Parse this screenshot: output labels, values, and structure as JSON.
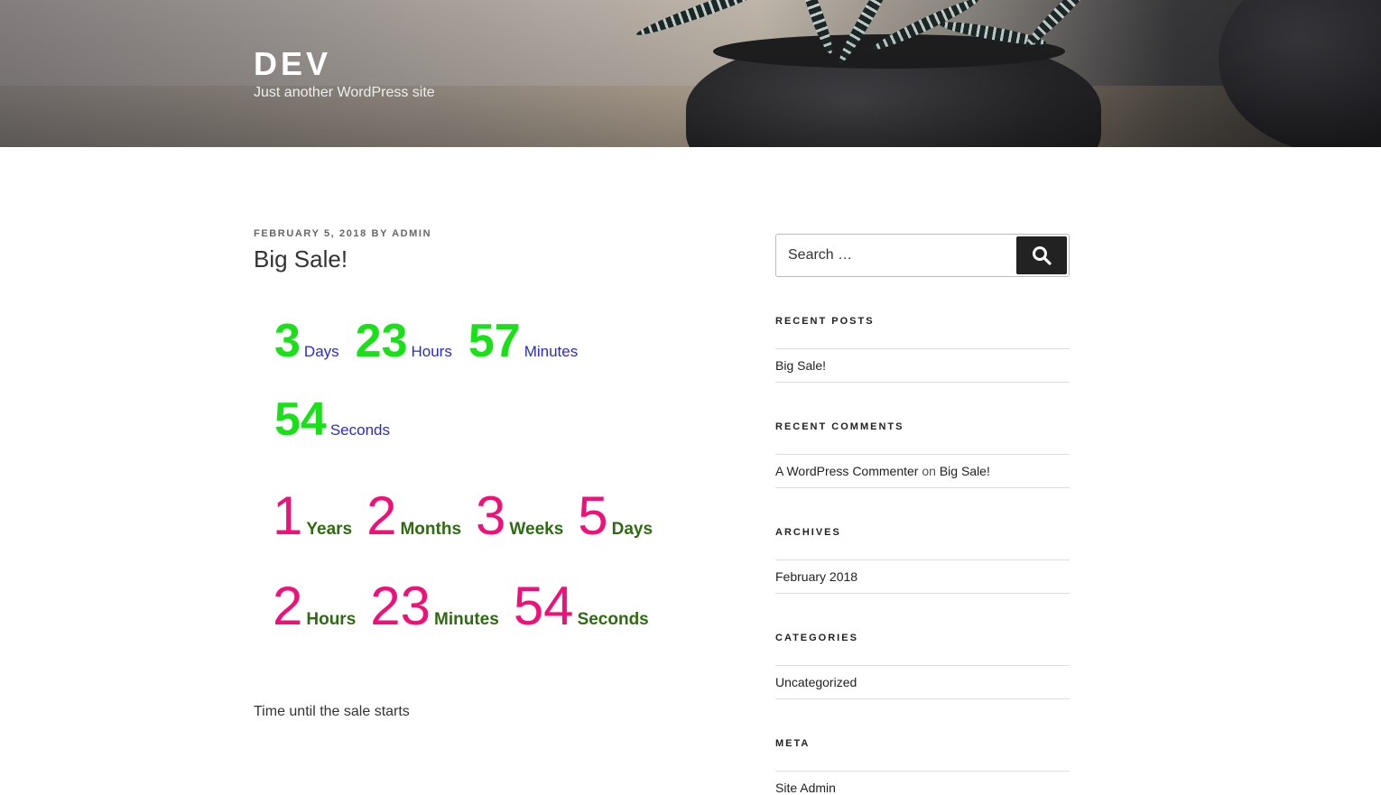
{
  "header": {
    "title": "DEV",
    "description": "Just another WordPress site"
  },
  "post": {
    "date": "FEBRUARY 5, 2018",
    "by": "BY",
    "author": "ADMIN",
    "title": "Big Sale!",
    "countdown_a": [
      {
        "value": "3",
        "label": "Days"
      },
      {
        "value": "23",
        "label": "Hours"
      },
      {
        "value": "57",
        "label": "Minutes"
      },
      {
        "value": "54",
        "label": "Seconds"
      }
    ],
    "countdown_b": [
      {
        "value": "1",
        "label": "Years"
      },
      {
        "value": "2",
        "label": "Months"
      },
      {
        "value": "3",
        "label": "Weeks"
      },
      {
        "value": "5",
        "label": "Days"
      },
      {
        "value": "2",
        "label": "Hours"
      },
      {
        "value": "23",
        "label": "Minutes"
      },
      {
        "value": "54",
        "label": "Seconds"
      }
    ],
    "text": "Time until the sale starts"
  },
  "sidebar": {
    "search_placeholder": "Search …",
    "recent_posts": {
      "title": "RECENT POSTS",
      "items": [
        "Big Sale!"
      ]
    },
    "recent_comments": {
      "title": "RECENT COMMENTS",
      "author": "A WordPress Commenter",
      "on": "on",
      "post": "Big Sale!"
    },
    "archives": {
      "title": "ARCHIVES",
      "items": [
        "February 2018"
      ]
    },
    "categories": {
      "title": "CATEGORIES",
      "items": [
        "Uncategorized"
      ]
    },
    "meta": {
      "title": "META",
      "items": [
        "Site Admin"
      ]
    }
  },
  "colors": {
    "countdown_a_number": "#1ae01a",
    "countdown_a_label": "#2a2ad0",
    "countdown_b_number": "#f0107a",
    "countdown_b_label": "#2f6b12"
  }
}
